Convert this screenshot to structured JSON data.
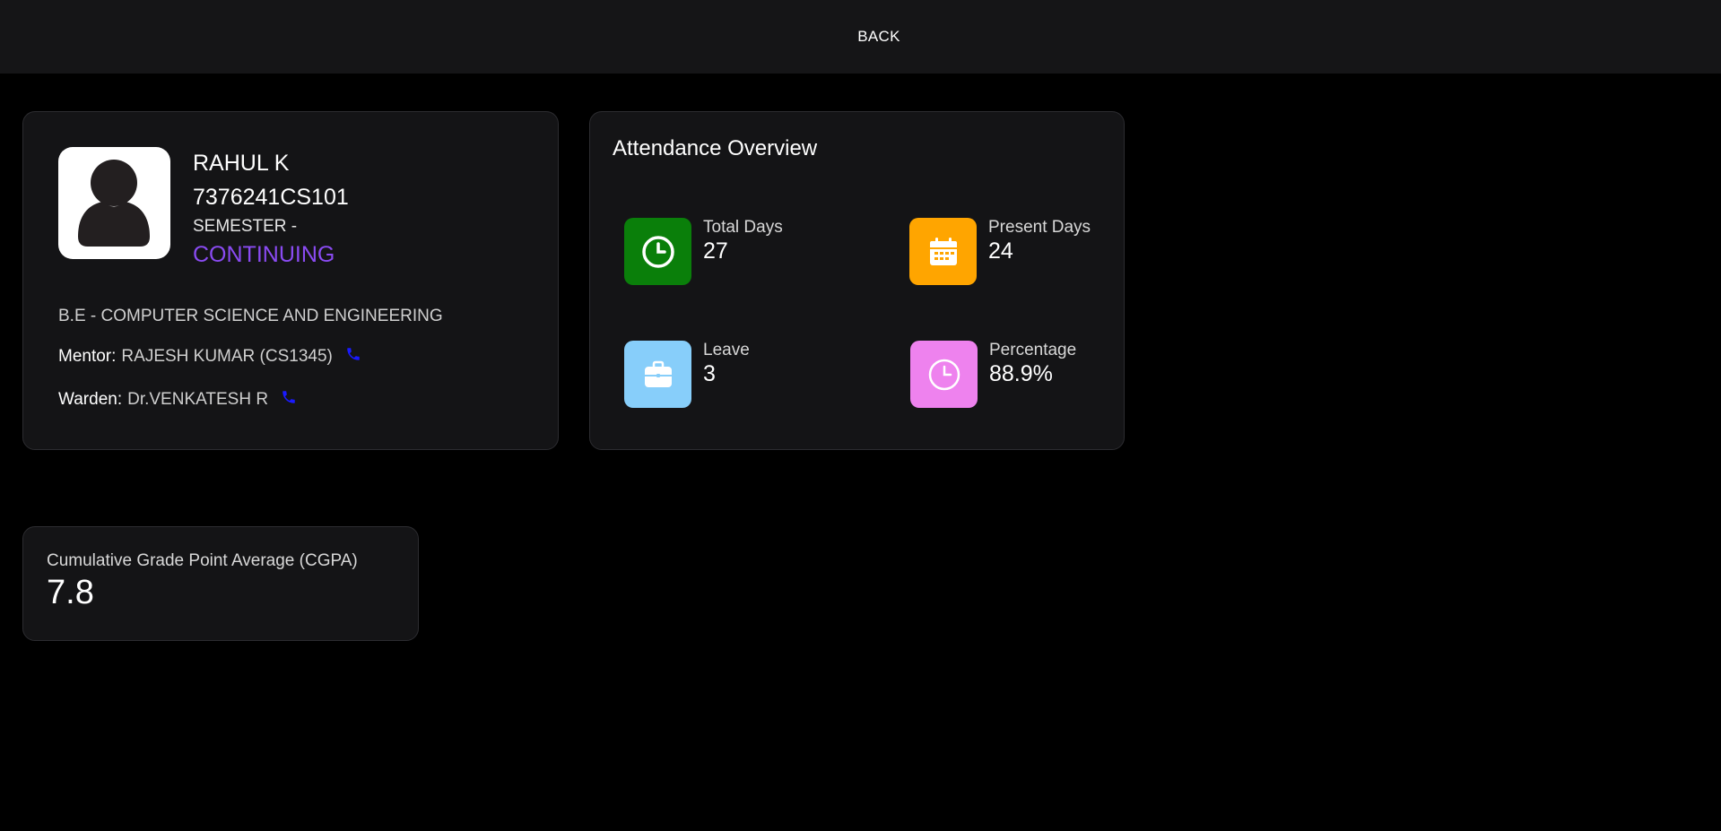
{
  "topbar": {
    "back_label": "BACK"
  },
  "profile": {
    "name": "RAHUL K",
    "roll_no": "7376241CS101",
    "semester_label": "SEMESTER -",
    "semester_status": "CONTINUING",
    "department": "B.E - COMPUTER SCIENCE AND ENGINEERING",
    "mentor_label": "Mentor:",
    "mentor_value": "RAJESH KUMAR (CS1345)",
    "warden_label": "Warden:",
    "warden_value": "Dr.VENKATESH R",
    "avatar_icon": "user-avatar-icon",
    "phone_icon": "phone-icon",
    "status_color": "#8a4bf2",
    "phone_color": "#1a1aff"
  },
  "attendance": {
    "title": "Attendance Overview",
    "stats": [
      {
        "label": "Total Days",
        "value": "27",
        "icon": "clock-icon",
        "color": "#0a7f0a"
      },
      {
        "label": "Present Days",
        "value": "24",
        "icon": "calendar-icon",
        "color": "#ffa500"
      },
      {
        "label": "Leave",
        "value": "3",
        "icon": "briefcase-icon",
        "color": "#87cefa"
      },
      {
        "label": "Percentage",
        "value": "88.9%",
        "icon": "clock-icon",
        "color": "#ee82ee"
      }
    ]
  },
  "cgpa": {
    "label": "Cumulative Grade Point Average (CGPA)",
    "value": "7.8"
  }
}
